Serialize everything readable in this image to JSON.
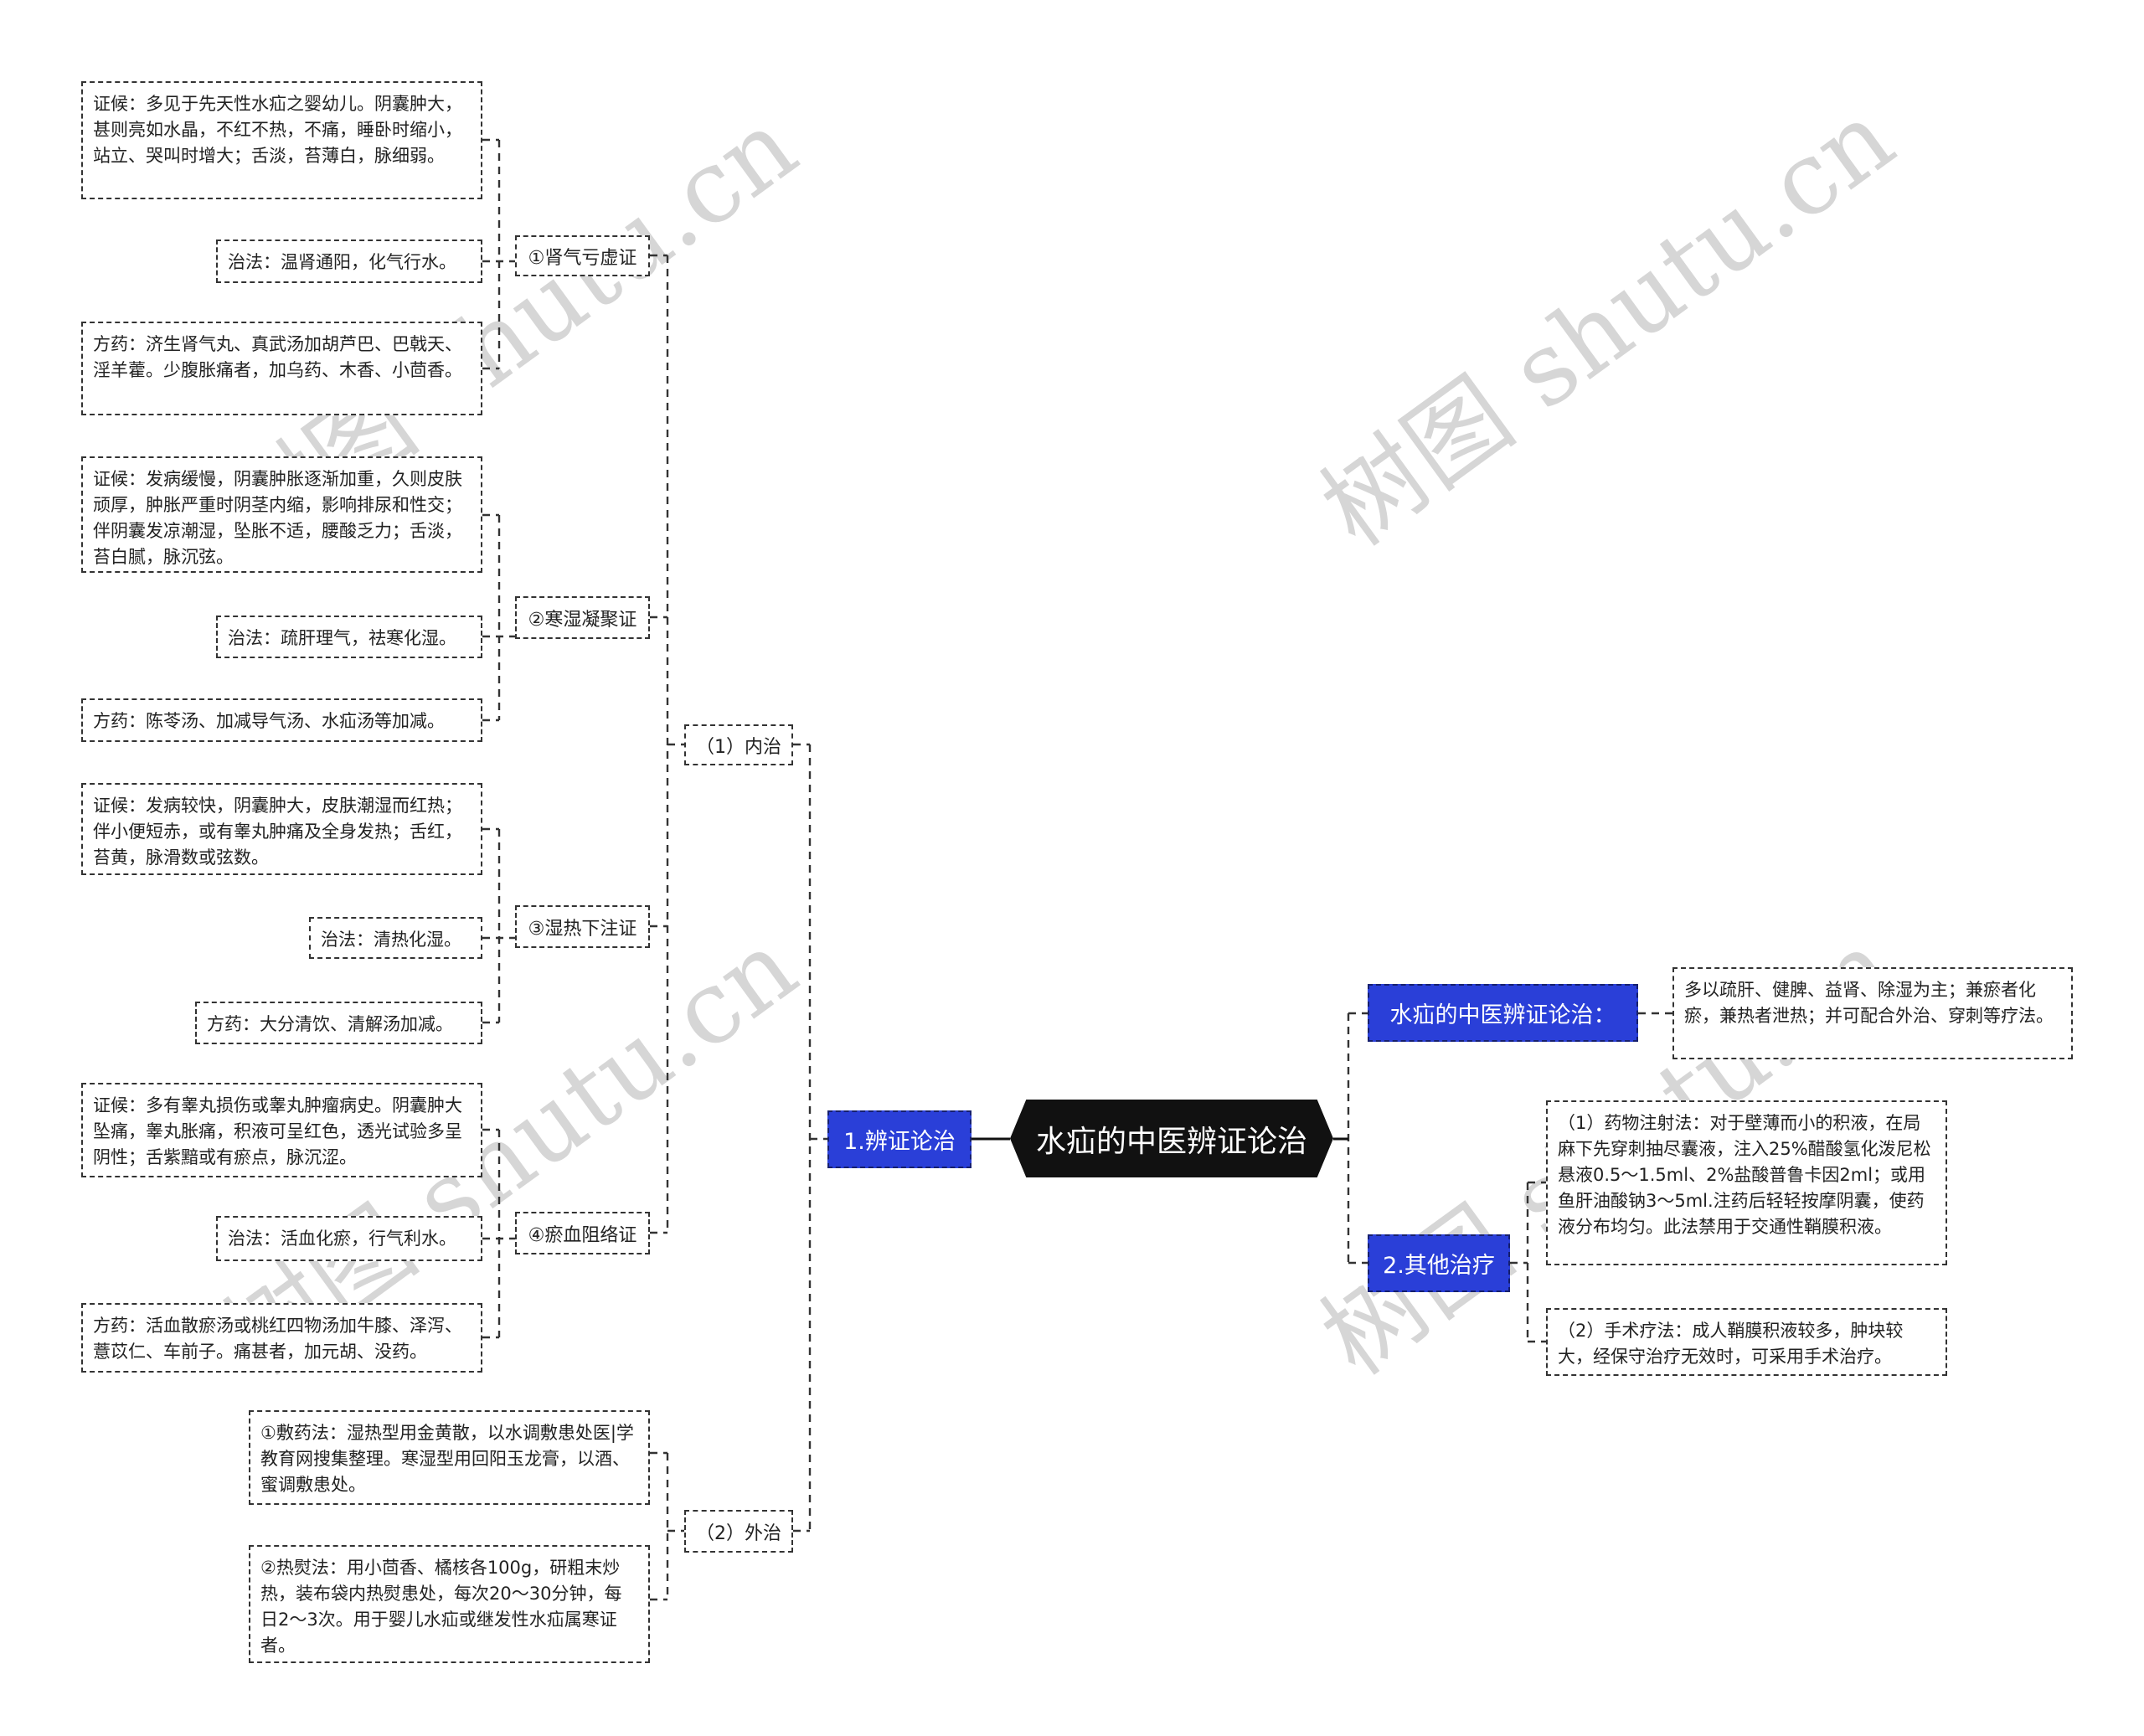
{
  "root": {
    "label": "水疝的中医辨证论治"
  },
  "watermark": "树图 shutu.cn",
  "colors": {
    "branch_blue": "#2a3fd8",
    "root_bg": "#111111",
    "line": "#333333"
  },
  "left": {
    "branch": {
      "label": "1.辨证论治"
    },
    "internal": {
      "label": "（1）内治",
      "syndromes": [
        {
          "label": "①肾气亏虚证",
          "symptoms": "证候：多见于先天性水疝之婴幼儿。阴囊肿大，甚则亮如水晶，不红不热，不痛，睡卧时缩小，站立、哭叫时增大；舌淡，苔薄白，脉细弱。",
          "treatment": "治法：温肾通阳，化气行水。",
          "prescription": "方药：济生肾气丸、真武汤加胡芦巴、巴戟天、淫羊藿。少腹胀痛者，加乌药、木香、小茴香。"
        },
        {
          "label": "②寒湿凝聚证",
          "symptoms": "证候：发病缓慢，阴囊肿胀逐渐加重，久则皮肤顽厚，肿胀严重时阴茎内缩，影响排尿和性交；伴阴囊发凉潮湿，坠胀不适，腰酸乏力；舌淡，苔白腻，脉沉弦。",
          "treatment": "治法：疏肝理气，祛寒化湿。",
          "prescription": "方药：陈苓汤、加减导气汤、水疝汤等加减。"
        },
        {
          "label": "③湿热下注证",
          "symptoms": "证候：发病较快，阴囊肿大，皮肤潮湿而红热；伴小便短赤，或有睾丸肿痛及全身发热；舌红，苔黄，脉滑数或弦数。",
          "treatment": "治法：清热化湿。",
          "prescription": "方药：大分清饮、清解汤加减。"
        },
        {
          "label": "④瘀血阻络证",
          "symptoms": "证候：多有睾丸损伤或睾丸肿瘤病史。阴囊肿大坠痛，睾丸胀痛，积液可呈红色，透光试验多呈阴性；舌紫黯或有瘀点，脉沉涩。",
          "treatment": "治法：活血化瘀，行气利水。",
          "prescription": "方药：活血散瘀汤或桃红四物汤加牛膝、泽泻、薏苡仁、车前子。痛甚者，加元胡、没药。"
        }
      ]
    },
    "external": {
      "label": "（2）外治",
      "items": [
        "①敷药法：湿热型用金黄散，以水调敷患处医|学教育网搜集整理。寒湿型用回阳玉龙膏，以酒、蜜调敷患处。",
        "②热熨法：用小茴香、橘核各100g，研粗末炒热，装布袋内热熨患处，每次20～30分钟，每日2～3次。用于婴儿水疝或继发性水疝属寒证者。"
      ]
    }
  },
  "right": {
    "principle": {
      "label": "水疝的中医辨证论治：",
      "text": "多以疏肝、健脾、益肾、除湿为主；兼瘀者化瘀，兼热者泄热；并可配合外治、穿刺等疗法。"
    },
    "other": {
      "label": "2.其他治疗",
      "items": [
        "（1）药物注射法：对于壁薄而小的积液，在局麻下先穿刺抽尽囊液，注入25%醋酸氢化泼尼松悬液0.5～1.5ml、2%盐酸普鲁卡因2ml；或用鱼肝油酸钠3～5ml.注药后轻轻按摩阴囊，使药液分布均匀。此法禁用于交通性鞘膜积液。",
        "（2）手术疗法：成人鞘膜积液较多，肿块较大，经保守治疗无效时，可采用手术治疗。"
      ]
    }
  }
}
